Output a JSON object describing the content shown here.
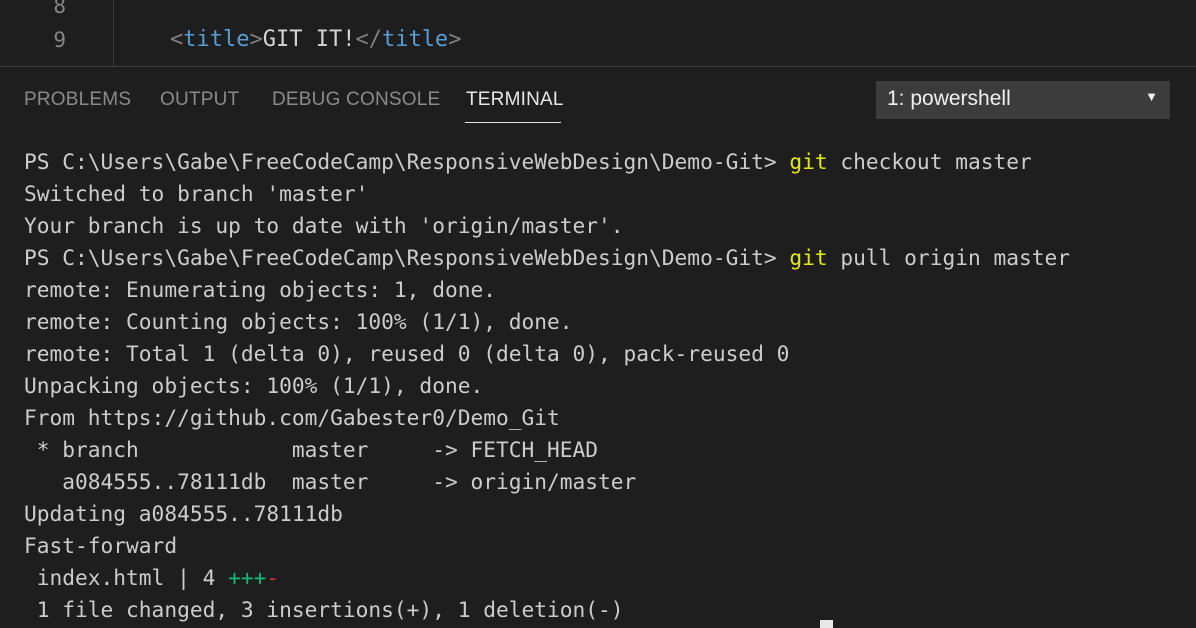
{
  "editor": {
    "lines": [
      {
        "number": "8",
        "code": ""
      },
      {
        "number": "9",
        "open_tag": "<title>",
        "text": "GIT IT!",
        "close_tag": "</title>"
      }
    ]
  },
  "panel": {
    "tabs": [
      "PROBLEMS",
      "OUTPUT",
      "DEBUG CONSOLE",
      "TERMINAL"
    ],
    "active_tab": "TERMINAL",
    "terminal_selector": "1: powershell"
  },
  "terminal": {
    "lines": [
      {
        "prompt": "PS C:\\Users\\Gabe\\FreeCodeCamp\\ResponsiveWebDesign\\Demo-Git> ",
        "cmd": "git",
        "args": " checkout master"
      },
      {
        "text": "Switched to branch 'master'"
      },
      {
        "text": "Your branch is up to date with 'origin/master'."
      },
      {
        "prompt": "PS C:\\Users\\Gabe\\FreeCodeCamp\\ResponsiveWebDesign\\Demo-Git> ",
        "cmd": "git",
        "args": " pull origin master"
      },
      {
        "text": "remote: Enumerating objects: 1, done."
      },
      {
        "text": "remote: Counting objects: 100% (1/1), done."
      },
      {
        "text": "remote: Total 1 (delta 0), reused 0 (delta 0), pack-reused 0"
      },
      {
        "text": "Unpacking objects: 100% (1/1), done."
      },
      {
        "text": "From https://github.com/Gabester0/Demo_Git"
      },
      {
        "text": " * branch            master     -> FETCH_HEAD"
      },
      {
        "text": "   a084555..78111db  master     -> origin/master"
      },
      {
        "text": "Updating a084555..78111db"
      },
      {
        "text": "Fast-forward"
      },
      {
        "text": " index.html | 4 ",
        "plus": "+++",
        "minus": "-"
      },
      {
        "text": " 1 file changed, 3 insertions(+), 1 deletion(-)"
      }
    ]
  }
}
